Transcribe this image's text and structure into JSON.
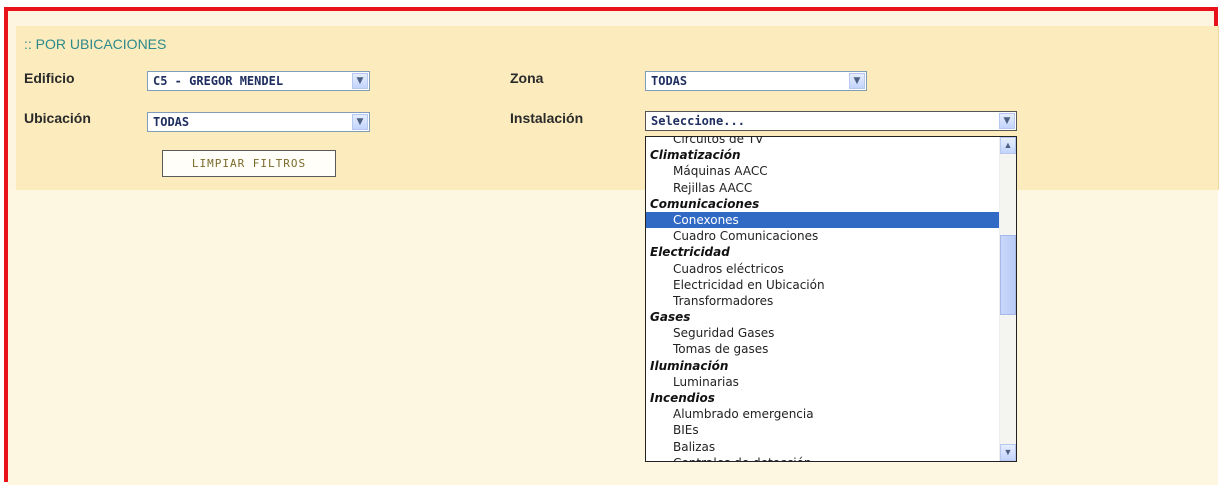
{
  "section_title": ":: POR UBICACIONES",
  "filters": {
    "edificio": {
      "label": "Edificio",
      "value": "C5 - GREGOR MENDEL"
    },
    "zona": {
      "label": "Zona",
      "value": "TODAS"
    },
    "ubicacion": {
      "label": "Ubicación",
      "value": "TODAS"
    },
    "instalacion": {
      "label": "Instalación",
      "value": "Seleccione..."
    }
  },
  "clear_button": "LIMPIAR FILTROS",
  "icons": {
    "dropdown_arrow": "chevron-down-icon",
    "scroll_up": "chevron-up-icon",
    "scroll_down": "chevron-down-icon"
  },
  "colors": {
    "frame_border": "#e8131a",
    "panel_background": "#fbebbd",
    "selected_option": "#316ac5",
    "section_title": "#2d8a8a"
  },
  "instalacion_options": [
    {
      "type": "item",
      "label": "Circuitos de TV"
    },
    {
      "type": "group",
      "label": "Climatización"
    },
    {
      "type": "item",
      "label": "Máquinas AACC"
    },
    {
      "type": "item",
      "label": "Rejillas AACC"
    },
    {
      "type": "group",
      "label": "Comunicaciones"
    },
    {
      "type": "item",
      "label": "Conexones",
      "highlighted": true
    },
    {
      "type": "item",
      "label": "Cuadro Comunicaciones"
    },
    {
      "type": "group",
      "label": "Electricidad"
    },
    {
      "type": "item",
      "label": "Cuadros eléctricos"
    },
    {
      "type": "item",
      "label": "Electricidad en Ubicación"
    },
    {
      "type": "item",
      "label": "Transformadores"
    },
    {
      "type": "group",
      "label": "Gases"
    },
    {
      "type": "item",
      "label": "Seguridad Gases"
    },
    {
      "type": "item",
      "label": "Tomas de gases"
    },
    {
      "type": "group",
      "label": "Iluminación"
    },
    {
      "type": "item",
      "label": "Luminarias"
    },
    {
      "type": "group",
      "label": "Incendios"
    },
    {
      "type": "item",
      "label": "Alumbrado emergencia"
    },
    {
      "type": "item",
      "label": "BIEs"
    },
    {
      "type": "item",
      "label": "Balizas"
    },
    {
      "type": "item",
      "label": "Centrales de detección"
    }
  ]
}
